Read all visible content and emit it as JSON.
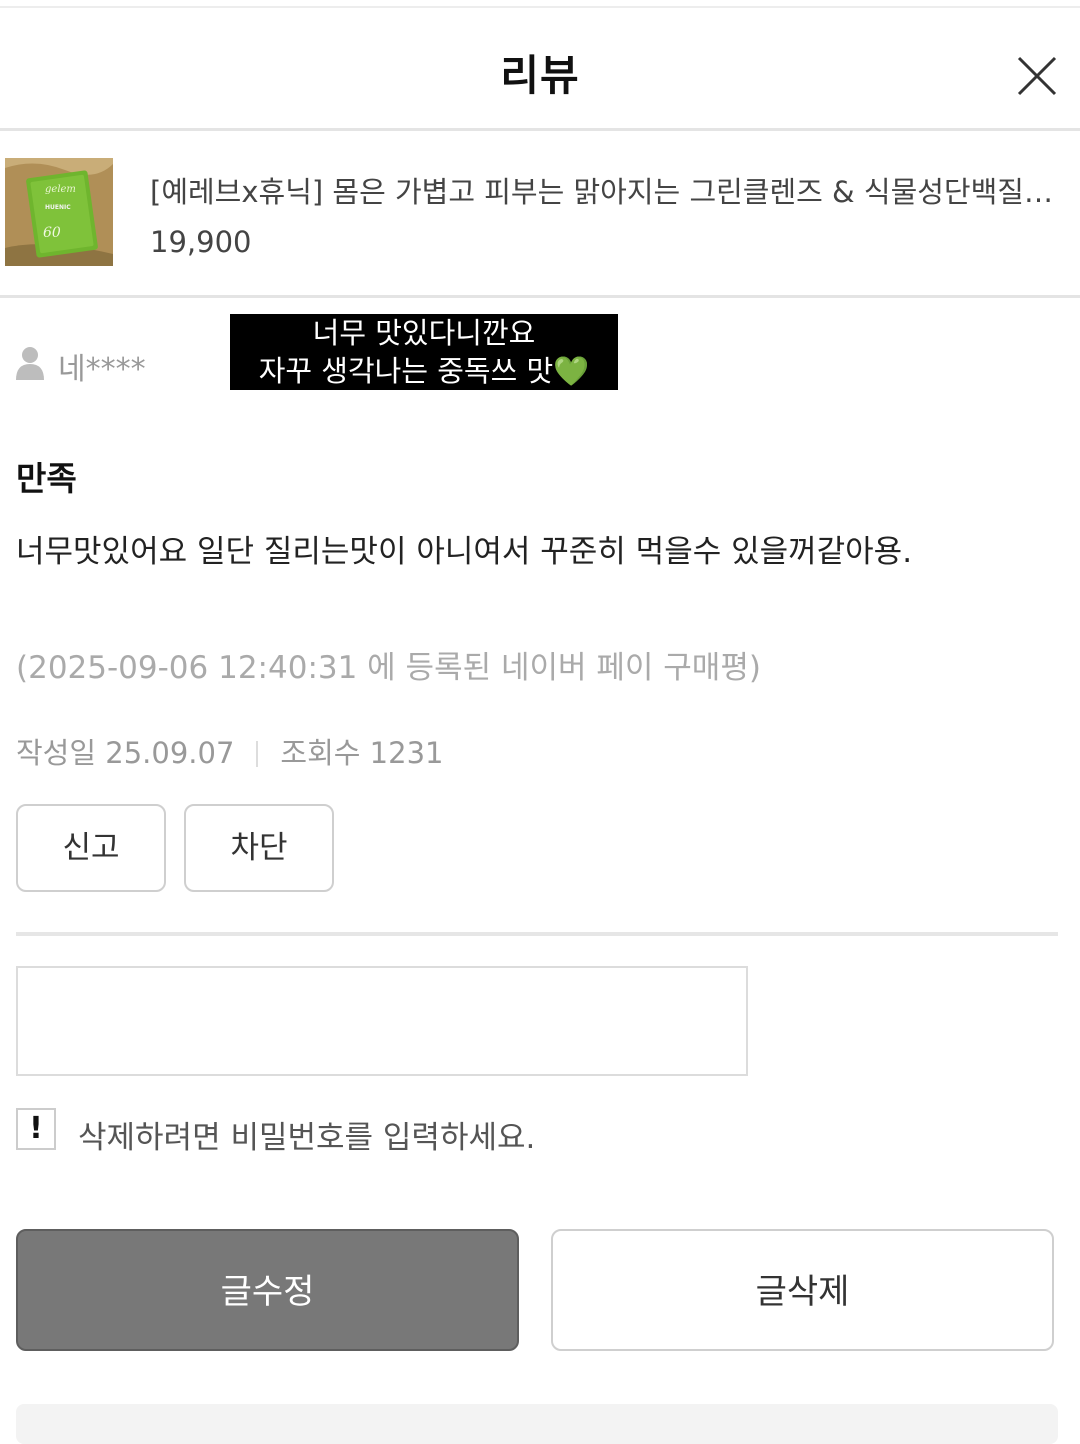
{
  "header": {
    "title": "리뷰",
    "close_icon": "close-icon"
  },
  "product": {
    "name": "[예레브x휴닉] 몸은 가볍고 피부는 맑아지는 그린클렌즈 & 식물성단백질 쉐이크",
    "price": "19,900",
    "thumbnail": {
      "brand_text": "HUENIC",
      "script_text": "gelem",
      "percent_text": "60"
    }
  },
  "reviewer": {
    "nickname": "네****",
    "avatar_icon": "user-icon"
  },
  "photo_caption": {
    "line1": "너무 맛있다니깐요",
    "line2": "자꾸 생각나는 중독쓰 맛",
    "emoji": "💚"
  },
  "review": {
    "rating_label": "만족",
    "text": "너무맛있어요 일단 질리는맛이 아니여서 꾸준히 먹을수 있을꺼같아용.",
    "source_note": "(2025-09-06 12:40:31 에 등록된 네이버 페이 구매평)",
    "date_label": "작성일 25.09.07",
    "views_label": "조회수 1231"
  },
  "actions": {
    "report_label": "신고",
    "block_label": "차단"
  },
  "delete_form": {
    "password_placeholder": "",
    "warning_icon": "!",
    "warning_text": "삭제하려면 비밀번호를 입력하세요."
  },
  "footer_buttons": {
    "edit_label": "글수정",
    "delete_label": "글삭제"
  },
  "colors": {
    "edit_button_bg": "#787878",
    "caption_bg": "#000000",
    "thumbnail_green": "#6fb52e"
  }
}
